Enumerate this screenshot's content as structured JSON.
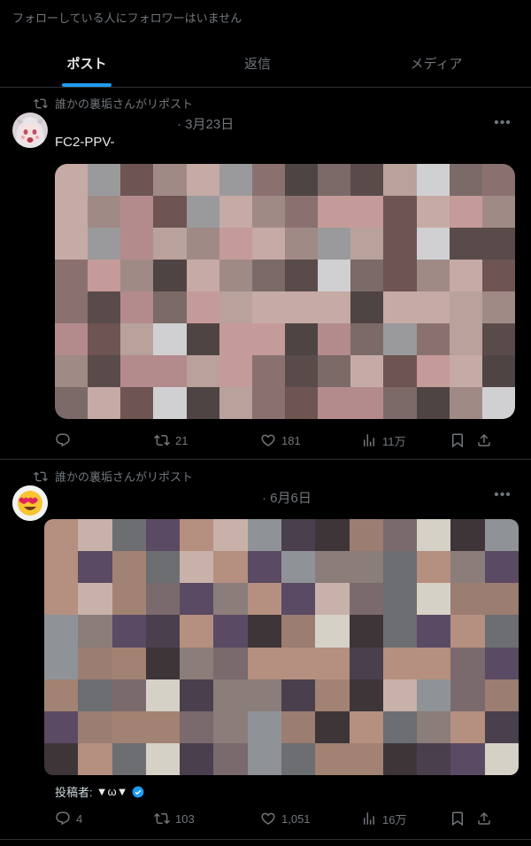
{
  "header": {
    "follow_note": "フォローしている人にフォロワーはいません"
  },
  "tabs": [
    {
      "label": "ポスト",
      "active": true
    },
    {
      "label": "返信",
      "active": false
    },
    {
      "label": "メディア",
      "active": false
    }
  ],
  "posts": [
    {
      "repost_label": "誰かの裏垢さんがリポスト",
      "date": "· 3月23日",
      "text": "FC2-PPV-",
      "stats": {
        "replies": "",
        "reposts": "21",
        "likes": "181",
        "views": "11万"
      }
    },
    {
      "repost_label": "誰かの裏垢さんがリポスト",
      "date": "· 6月6日",
      "credit_label": "投稿者:",
      "credit_name": "▼ω▼",
      "stats": {
        "replies": "4",
        "reposts": "103",
        "likes": "1,051",
        "views": "16万"
      }
    }
  ],
  "colors": {
    "accent": "#1d9bf0",
    "muted": "#71767b",
    "text": "#e7e9ea",
    "divider": "#2f3336"
  }
}
